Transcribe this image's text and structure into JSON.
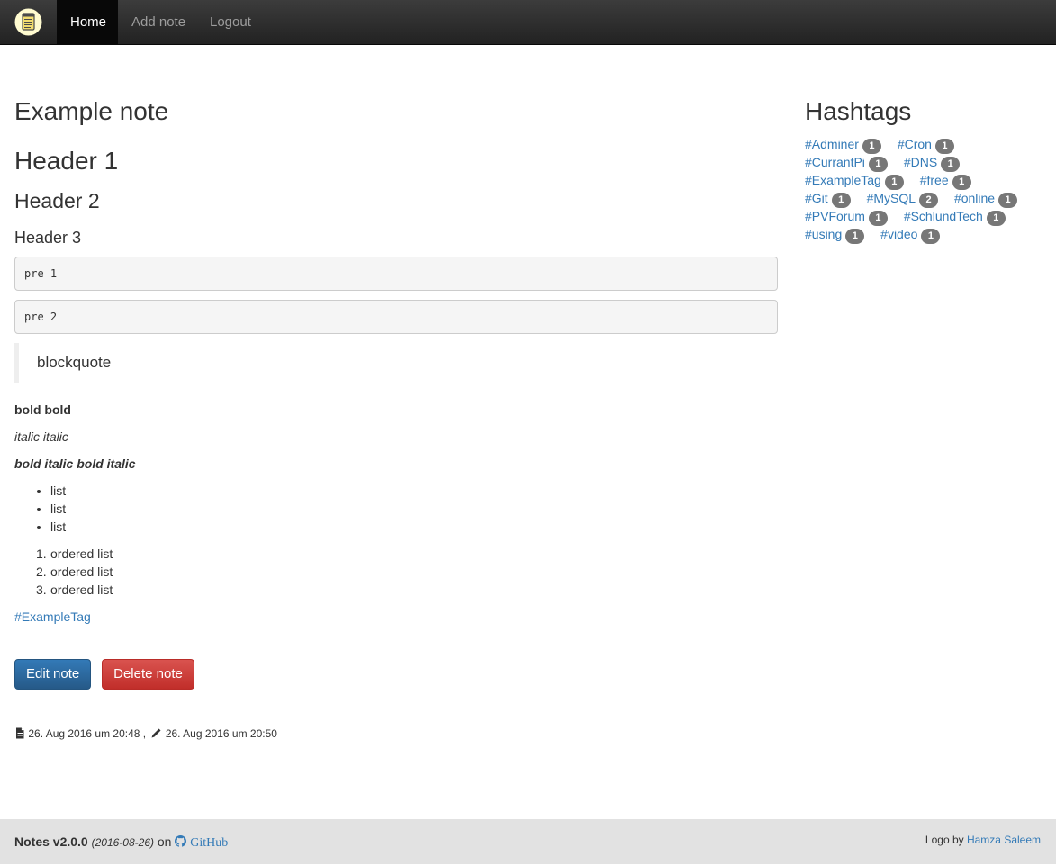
{
  "navbar": {
    "logo": "notepad-logo",
    "items": [
      {
        "label": "Home",
        "active": true
      },
      {
        "label": "Add note",
        "active": false
      },
      {
        "label": "Logout",
        "active": false
      }
    ]
  },
  "note": {
    "title": "Example note",
    "header1": "Header 1",
    "header2": "Header 2",
    "header3": "Header 3",
    "pre1": "pre 1",
    "pre2": "pre 2",
    "blockquote": "blockquote",
    "bold": "bold bold",
    "italic": "italic italic",
    "bold_italic": "bold italic bold italic",
    "list": [
      "list",
      "list",
      "list"
    ],
    "ordered_list": [
      "ordered list",
      "ordered list",
      "ordered list"
    ],
    "hashtag": "#ExampleTag",
    "edit_label": "Edit note",
    "delete_label": "Delete note",
    "created": "26. Aug 2016 um 20:48",
    "separator": ",",
    "modified": "26. Aug 2016 um 20:50"
  },
  "sidebar": {
    "title": "Hashtags",
    "tags": [
      [
        {
          "name": "#Adminer",
          "count": "1"
        },
        {
          "name": "#Cron",
          "count": "1"
        }
      ],
      [
        {
          "name": "#CurrantPi",
          "count": "1"
        },
        {
          "name": "#DNS",
          "count": "1"
        }
      ],
      [
        {
          "name": "#ExampleTag",
          "count": "1"
        },
        {
          "name": "#free",
          "count": "1"
        }
      ],
      [
        {
          "name": "#Git",
          "count": "1"
        },
        {
          "name": "#MySQL",
          "count": "2"
        },
        {
          "name": "#online",
          "count": "1"
        }
      ],
      [
        {
          "name": "#PVForum",
          "count": "1"
        },
        {
          "name": "#SchlundTech",
          "count": "1"
        }
      ],
      [
        {
          "name": "#using",
          "count": "1"
        },
        {
          "name": "#video",
          "count": "1"
        }
      ]
    ]
  },
  "footer": {
    "app": "Notes v2.0.0",
    "date": "(2016-08-26)",
    "on": "on",
    "github": "GitHub",
    "logo_by": "Logo by",
    "author": "Hamza Saleem"
  },
  "colors": {
    "navbar": "#222222",
    "link": "#337ab7",
    "primary": "#337ab7",
    "danger": "#d9534f",
    "badge": "#777777",
    "footer": "#e2e2e2"
  }
}
